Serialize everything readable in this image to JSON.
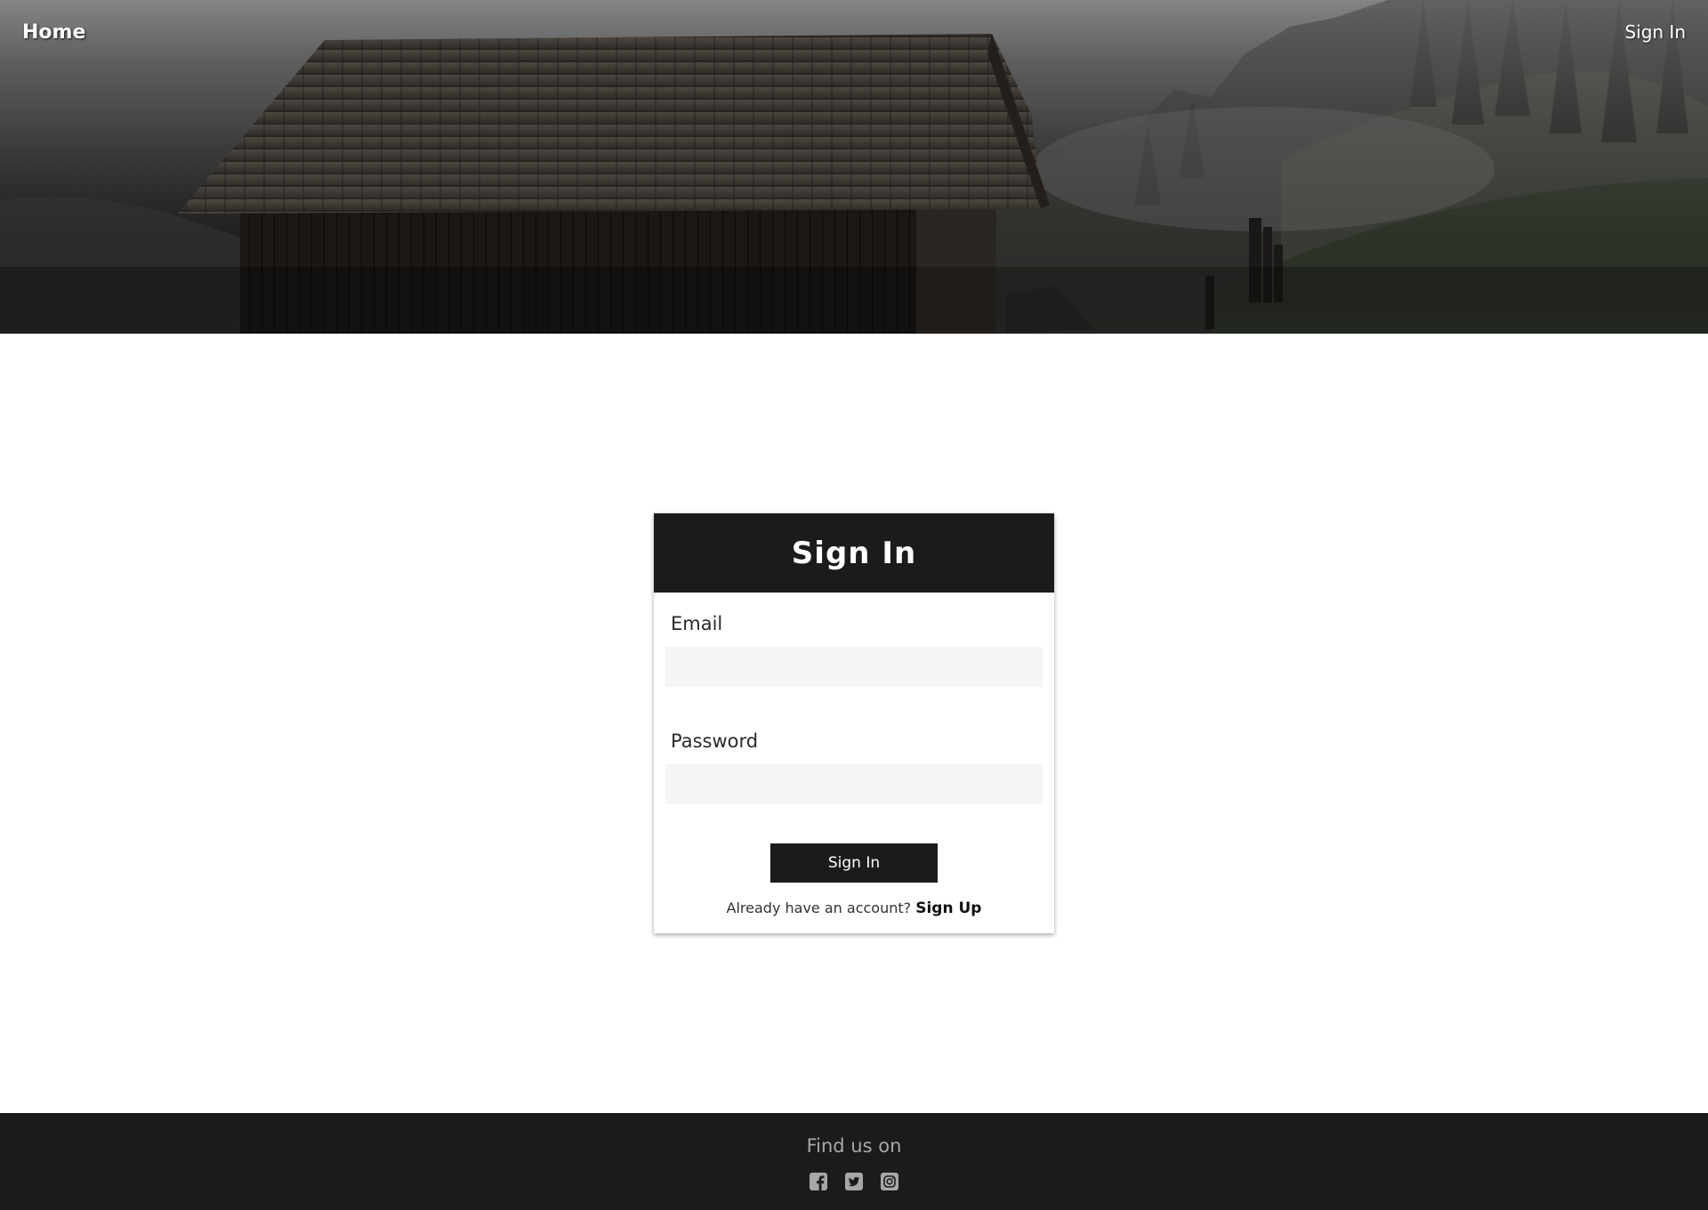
{
  "nav": {
    "home_label": "Home",
    "signin_label": "Sign In"
  },
  "signin_form": {
    "title": "Sign In",
    "email_label": "Email",
    "email_value": "",
    "password_label": "Password",
    "password_value": "",
    "submit_label": "Sign In",
    "switch_prompt": "Already have an account?",
    "switch_link": "Sign Up"
  },
  "footer": {
    "heading": "Find us on",
    "social_icons": [
      "facebook-icon",
      "twitter-icon",
      "instagram-icon"
    ]
  },
  "colors": {
    "dark": "#1b1b1b",
    "input_bg": "#f5f5f5",
    "footer_text": "#a7a7a7",
    "page_bg": "#ffffff"
  }
}
